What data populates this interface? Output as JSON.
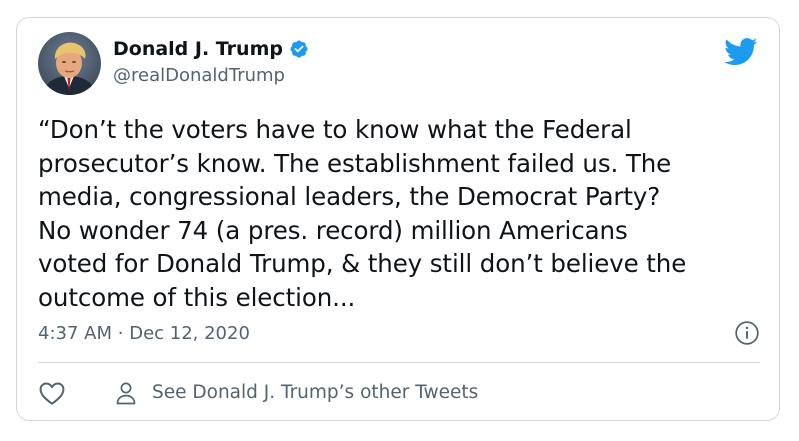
{
  "tweet": {
    "author": {
      "display_name": "Donald J. Trump",
      "handle": "@realDonaldTrump",
      "verified": true
    },
    "text_lines": [
      "“Don’t the voters have to know what the Federal",
      "prosecutor’s know. The establishment failed us. The",
      "media, congressional leaders, the Democrat Party?",
      "No wonder 74 (a pres. record) million Americans",
      "voted for Donald Trump, & they still don’t believe the",
      "outcome of this election..."
    ],
    "time": "4:37 AM",
    "separator": "·",
    "date": "Dec 12, 2020",
    "other_tweets_label": "See Donald J. Trump’s other Tweets"
  },
  "icons": {
    "brand": "twitter-bird-icon",
    "verified": "verified-badge-icon",
    "info": "info-icon",
    "like": "heart-icon",
    "profile": "person-icon"
  },
  "colors": {
    "brand_blue": "#1d9bf0",
    "text_primary": "#0f1419",
    "text_secondary": "#536471",
    "border": "#cfd9de"
  }
}
